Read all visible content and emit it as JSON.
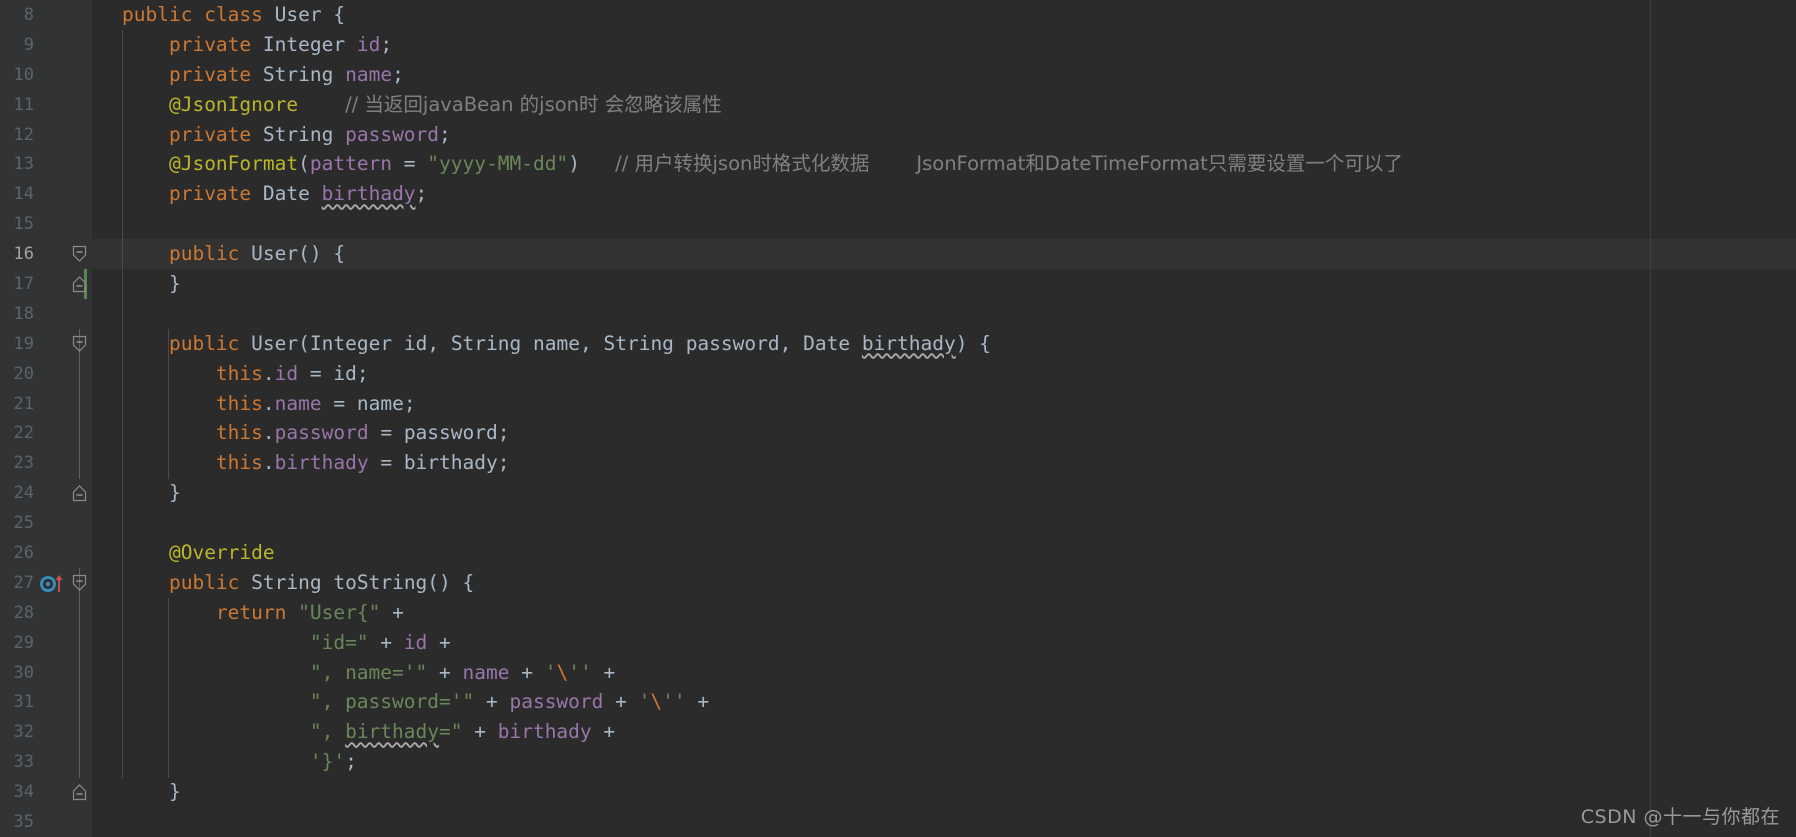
{
  "editor": {
    "theme": "darcula",
    "language": "java",
    "first_line": 8,
    "last_line": 35,
    "current_line": 16,
    "colors": {
      "background": "#2b2b2b",
      "gutter_background": "#313335",
      "current_line_background": "#323232",
      "default_text": "#a9b7c6",
      "keyword": "#cc7832",
      "string": "#6a8759",
      "comment": "#808080",
      "annotation": "#bbb529",
      "field": "#9876aa",
      "line_number": "#606366",
      "line_number_active": "#a4a3a3",
      "vcs_added_stripe": "#629755",
      "override_icon_circle": "#3592c4",
      "override_icon_arrow": "#c75450"
    }
  },
  "line_numbers": [
    8,
    9,
    10,
    11,
    12,
    13,
    14,
    15,
    16,
    17,
    18,
    19,
    20,
    21,
    22,
    23,
    24,
    25,
    26,
    27,
    28,
    29,
    30,
    31,
    32,
    33,
    34,
    35
  ],
  "gutter_icons": [
    {
      "line": 27,
      "name": "overrides-method-icon",
      "tooltip": "Overrides method in Object"
    }
  ],
  "fold_markers": [
    {
      "line": 16,
      "state": "expanded-start"
    },
    {
      "line": 17,
      "state": "expanded-end"
    },
    {
      "line": 19,
      "state": "expanded-start"
    },
    {
      "line": 24,
      "state": "expanded-end"
    },
    {
      "line": 27,
      "state": "expanded-start"
    },
    {
      "line": 34,
      "state": "expanded-end"
    }
  ],
  "vcs_change_markers": [
    {
      "from_line": 16,
      "to_line": 17,
      "type": "added"
    }
  ],
  "code_lines": [
    {
      "n": 8,
      "text": "public class User {"
    },
    {
      "n": 9,
      "text": "    private Integer id;"
    },
    {
      "n": 10,
      "text": "    private String name;"
    },
    {
      "n": 11,
      "text": "    @JsonIgnore    // 当返回javaBean 的json时 会忽略该属性"
    },
    {
      "n": 12,
      "text": "    private String password;"
    },
    {
      "n": 13,
      "text": "    @JsonFormat(pattern = \"yyyy-MM-dd\")   // 用户转换json时格式化数据    JsonFormat和DateTimeFormat只需要设置一个可以了"
    },
    {
      "n": 14,
      "text": "    private Date birthady;"
    },
    {
      "n": 15,
      "text": ""
    },
    {
      "n": 16,
      "text": "    public User() {"
    },
    {
      "n": 17,
      "text": "    }"
    },
    {
      "n": 18,
      "text": ""
    },
    {
      "n": 19,
      "text": "    public User(Integer id, String name, String password, Date birthady) {"
    },
    {
      "n": 20,
      "text": "        this.id = id;"
    },
    {
      "n": 21,
      "text": "        this.name = name;"
    },
    {
      "n": 22,
      "text": "        this.password = password;"
    },
    {
      "n": 23,
      "text": "        this.birthady = birthady;"
    },
    {
      "n": 24,
      "text": "    }"
    },
    {
      "n": 25,
      "text": ""
    },
    {
      "n": 26,
      "text": "    @Override"
    },
    {
      "n": 27,
      "text": "    public String toString() {"
    },
    {
      "n": 28,
      "text": "        return \"User{\" +"
    },
    {
      "n": 29,
      "text": "                \"id=\" + id +"
    },
    {
      "n": 30,
      "text": "                \", name='\" + name + '\\'' +"
    },
    {
      "n": 31,
      "text": "                \", password='\" + password + '\\'' +"
    },
    {
      "n": 32,
      "text": "                \", birthady=\" + birthady +"
    },
    {
      "n": 33,
      "text": "                '}';"
    },
    {
      "n": 34,
      "text": "    }"
    },
    {
      "n": 35,
      "text": ""
    }
  ],
  "comments": {
    "line11": "// 当返回javaBean 的json时 会忽略该属性",
    "line13_a": "// 用户转换json时格式化数据",
    "line13_b": "JsonFormat和DateTimeFormat只需要设置一个可以了"
  },
  "watermark": {
    "text": "CSDN @十一与你都在"
  }
}
